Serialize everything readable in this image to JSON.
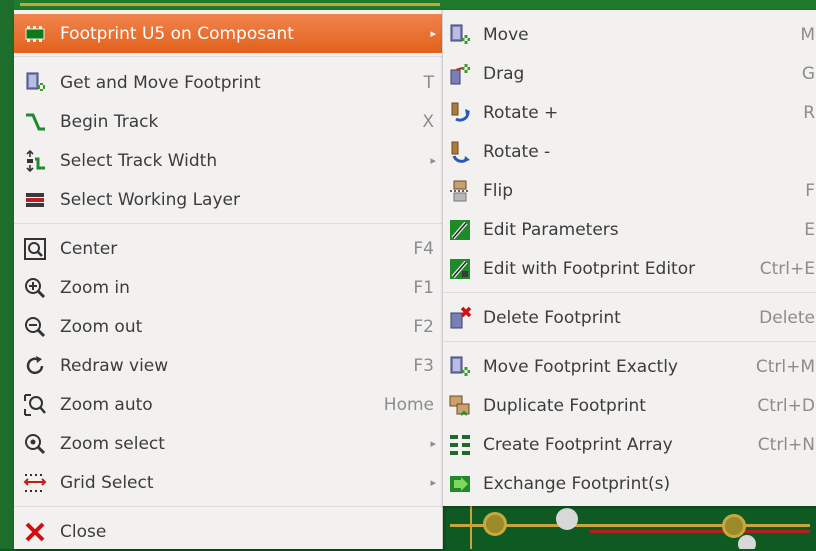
{
  "main_menu": {
    "header_item": {
      "label": "Footprint U5 on Composant",
      "icon": "footprint-icon"
    },
    "items": [
      {
        "label": "Get and Move Footprint",
        "shortcut": "T",
        "icon": "get-move-footprint-icon"
      },
      {
        "label": "Begin Track",
        "shortcut": "X",
        "icon": "begin-track-icon"
      },
      {
        "label": "Select Track Width",
        "shortcut": "",
        "icon": "track-width-icon"
      },
      {
        "label": "Select Working Layer",
        "shortcut": "",
        "icon": "layers-icon"
      },
      {
        "label": "Center",
        "shortcut": "F4",
        "icon": "center-icon"
      },
      {
        "label": "Zoom in",
        "shortcut": "F1",
        "icon": "zoom-in-icon"
      },
      {
        "label": "Zoom out",
        "shortcut": "F2",
        "icon": "zoom-out-icon"
      },
      {
        "label": "Redraw view",
        "shortcut": "F3",
        "icon": "redraw-icon"
      },
      {
        "label": "Zoom auto",
        "shortcut": "Home",
        "icon": "zoom-auto-icon"
      },
      {
        "label": "Zoom select",
        "shortcut": "",
        "icon": "zoom-select-icon"
      },
      {
        "label": "Grid Select",
        "shortcut": "",
        "icon": "grid-icon"
      },
      {
        "label": "Close",
        "shortcut": "",
        "icon": "close-icon"
      }
    ]
  },
  "submenu": {
    "items": [
      {
        "label": "Move",
        "shortcut": "M",
        "icon": "move-icon"
      },
      {
        "label": "Drag",
        "shortcut": "G",
        "icon": "drag-icon"
      },
      {
        "label": "Rotate +",
        "shortcut": "R",
        "icon": "rotate-ccw-icon"
      },
      {
        "label": "Rotate -",
        "shortcut": "",
        "icon": "rotate-cw-icon"
      },
      {
        "label": "Flip",
        "shortcut": "F",
        "icon": "flip-icon"
      },
      {
        "label": "Edit Parameters",
        "shortcut": "E",
        "icon": "edit-parameters-icon"
      },
      {
        "label": "Edit with Footprint Editor",
        "shortcut": "Ctrl+E",
        "icon": "footprint-editor-icon"
      },
      {
        "label": "Delete Footprint",
        "shortcut": "Delete",
        "icon": "delete-footprint-icon"
      },
      {
        "label": "Move Footprint Exactly",
        "shortcut": "Ctrl+M",
        "icon": "move-exact-icon"
      },
      {
        "label": "Duplicate Footprint",
        "shortcut": "Ctrl+D",
        "icon": "duplicate-icon"
      },
      {
        "label": "Create Footprint Array",
        "shortcut": "Ctrl+N",
        "icon": "array-icon"
      },
      {
        "label": "Exchange Footprint(s)",
        "shortcut": "",
        "icon": "exchange-icon"
      }
    ]
  },
  "submenu_arrow": "▸",
  "colors": {
    "highlight": "#e8702a",
    "menu_bg": "#f2f1f0",
    "pcb": "#0b5a1e"
  }
}
